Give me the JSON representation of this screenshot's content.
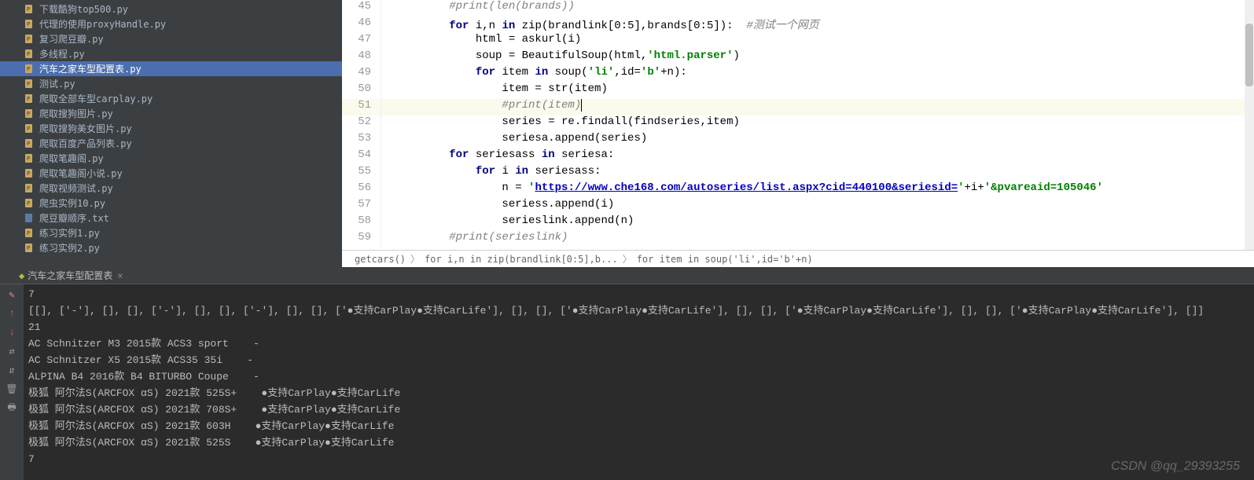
{
  "sidebar": {
    "files": [
      {
        "name": "下载酷狗top500.py",
        "selected": false,
        "type": "py"
      },
      {
        "name": "代理的使用proxyHandle.py",
        "selected": false,
        "type": "py"
      },
      {
        "name": "复习爬豆瓣.py",
        "selected": false,
        "type": "py"
      },
      {
        "name": "多线程.py",
        "selected": false,
        "type": "py"
      },
      {
        "name": "汽车之家车型配置表.py",
        "selected": true,
        "type": "py"
      },
      {
        "name": "测试.py",
        "selected": false,
        "type": "py"
      },
      {
        "name": "爬取全部车型carplay.py",
        "selected": false,
        "type": "py"
      },
      {
        "name": "爬取搜狗图片.py",
        "selected": false,
        "type": "py"
      },
      {
        "name": "爬取搜狗美女图片.py",
        "selected": false,
        "type": "py"
      },
      {
        "name": "爬取百度产品列表.py",
        "selected": false,
        "type": "py"
      },
      {
        "name": "爬取笔趣阁.py",
        "selected": false,
        "type": "py"
      },
      {
        "name": "爬取笔趣阁小说.py",
        "selected": false,
        "type": "py"
      },
      {
        "name": "爬取视频测试.py",
        "selected": false,
        "type": "py"
      },
      {
        "name": "爬虫实例10.py",
        "selected": false,
        "type": "py"
      },
      {
        "name": "爬豆瓣顺序.txt",
        "selected": false,
        "type": "txt"
      },
      {
        "name": "练习实例1.py",
        "selected": false,
        "type": "py"
      },
      {
        "name": "练习实例2.py",
        "selected": false,
        "type": "py"
      }
    ]
  },
  "editor": {
    "lines": [
      {
        "n": 45,
        "html": "        <span class='com'>#print(len(brands))</span>"
      },
      {
        "n": 46,
        "html": "        <span class='kw'>for</span> i,n <span class='kw'>in</span> zip(brandlink[<span>0</span>:<span>5</span>],brands[<span>0</span>:<span>5</span>]):  <span class='com'>#测试一个网页</span>"
      },
      {
        "n": 47,
        "html": "            html = askurl(i)"
      },
      {
        "n": 48,
        "html": "            soup = BeautifulSoup(html,<span class='str'>'html.parser'</span>)"
      },
      {
        "n": 49,
        "html": "            <span class='kw'>for</span> item <span class='kw'>in</span> soup(<span class='str'>'li'</span>,id=<span class='str'>'b'</span>+n):"
      },
      {
        "n": 50,
        "html": "                item = str(item)"
      },
      {
        "n": 51,
        "html": "                <span class='com'>#print(item)</span><span class='caret'></span>",
        "current": true
      },
      {
        "n": 52,
        "html": "                series = re.findall(findseries,item)"
      },
      {
        "n": 53,
        "html": "                seriesa.append(series)"
      },
      {
        "n": 54,
        "html": "        <span class='kw'>for</span> seriesass <span class='kw'>in</span> seriesa:"
      },
      {
        "n": 55,
        "html": "            <span class='kw'>for</span> i <span class='kw'>in</span> seriesass:"
      },
      {
        "n": 56,
        "html": "                n = <span class='str'>'</span><span class='link'>https://www.che168.com/autoseries/list.aspx?cid=440100&seriesid=</span><span class='str'>'</span>+i+<span class='str'>'&pvareaid=105046'</span>"
      },
      {
        "n": 57,
        "html": "                seriess.append(i)"
      },
      {
        "n": 58,
        "html": "                serieslink.append(n)"
      },
      {
        "n": 59,
        "html": "        <span class='com'>#print(serieslink)</span>"
      }
    ]
  },
  "breadcrumb": {
    "items": [
      "getcars()",
      "for i,n in zip(brandlink[0:5],b...",
      "for item in soup('li',id='b'+n)"
    ]
  },
  "tab": {
    "title": "汽车之家车型配置表",
    "close": "×"
  },
  "console": {
    "lines": [
      "7",
      "[[], ['-'], [], [], ['-'], [], [], ['-'], [], [], ['●支持CarPlay●支持CarLife'], [], [], ['●支持CarPlay●支持CarLife'], [], [], ['●支持CarPlay●支持CarLife'], [], [], ['●支持CarPlay●支持CarLife'], []]",
      "21",
      "AC Schnitzer M3 2015款 ACS3 sport    -",
      "AC Schnitzer X5 2015款 ACS35 35i    -",
      "ALPINA B4 2016款 B4 BITURBO Coupe    -",
      "极狐 阿尔法S(ARCFOX αS) 2021款 525S+    ●支持CarPlay●支持CarLife",
      "极狐 阿尔法S(ARCFOX αS) 2021款 708S+    ●支持CarPlay●支持CarLife",
      "极狐 阿尔法S(ARCFOX αS) 2021款 603H    ●支持CarPlay●支持CarLife",
      "极狐 阿尔法S(ARCFOX αS) 2021款 525S    ●支持CarPlay●支持CarLife",
      "7"
    ]
  },
  "watermark": "CSDN @qq_29393255",
  "tools": {
    "pencil": "✎",
    "up_red": "↑",
    "down_red": "↓",
    "wrap": "⇄",
    "wrap2": "⇵",
    "trash": "🗑",
    "print": "🖶"
  }
}
